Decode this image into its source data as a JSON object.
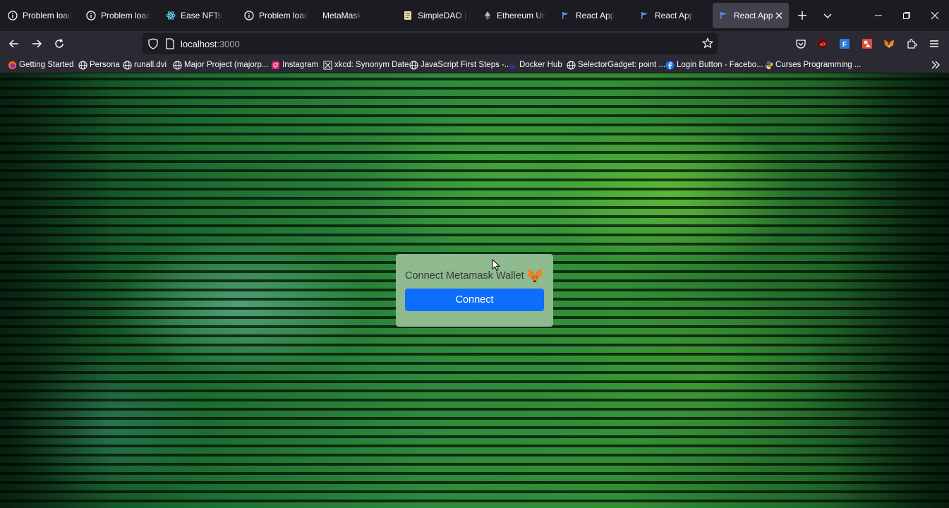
{
  "tabs": [
    {
      "title": "Problem loading page",
      "icon": "info-icon"
    },
    {
      "title": "Problem loading page",
      "icon": "info-icon"
    },
    {
      "title": "Ease NFTs",
      "icon": "react-icon"
    },
    {
      "title": "Problem loading page",
      "icon": "info-icon"
    },
    {
      "title": "MetaMask",
      "icon": "blank-icon"
    },
    {
      "title": "SimpleDAO | Ac",
      "icon": "document-icon"
    },
    {
      "title": "Ethereum Unit C",
      "icon": "ethereum-icon"
    },
    {
      "title": "React App",
      "icon": "flag-icon"
    },
    {
      "title": "React App",
      "icon": "flag-icon"
    },
    {
      "title": "React App",
      "icon": "flag-icon",
      "active": true
    }
  ],
  "url": {
    "host": "localhost",
    "port": ":3000"
  },
  "bookmarks": [
    {
      "label": "Getting Started",
      "icon": "firefox-icon"
    },
    {
      "label": "Persona",
      "icon": "globe-icon"
    },
    {
      "label": "runall.dvi",
      "icon": "globe-icon"
    },
    {
      "label": "Major Project (majorp...",
      "icon": "globe-icon"
    },
    {
      "label": "Instagram",
      "icon": "instagram-icon"
    },
    {
      "label": "xkcd: Synonym Date",
      "icon": "xkcd-icon"
    },
    {
      "label": "JavaScript First Steps -...",
      "icon": "globe-icon"
    },
    {
      "label": "Docker Hub",
      "icon": "docker-icon"
    },
    {
      "label": "SelectorGadget: point ...",
      "icon": "globe-icon"
    },
    {
      "label": "Login Button - Facebo...",
      "icon": "facebook-icon"
    },
    {
      "label": "Curses Programming ...",
      "icon": "python-icon"
    }
  ],
  "wallet": {
    "title": "Connect Metamask Wallet",
    "button_label": "Connect"
  },
  "colors": {
    "accent": "#0d6efd",
    "card": "#8fb98f",
    "active_tab": "#42414d"
  }
}
